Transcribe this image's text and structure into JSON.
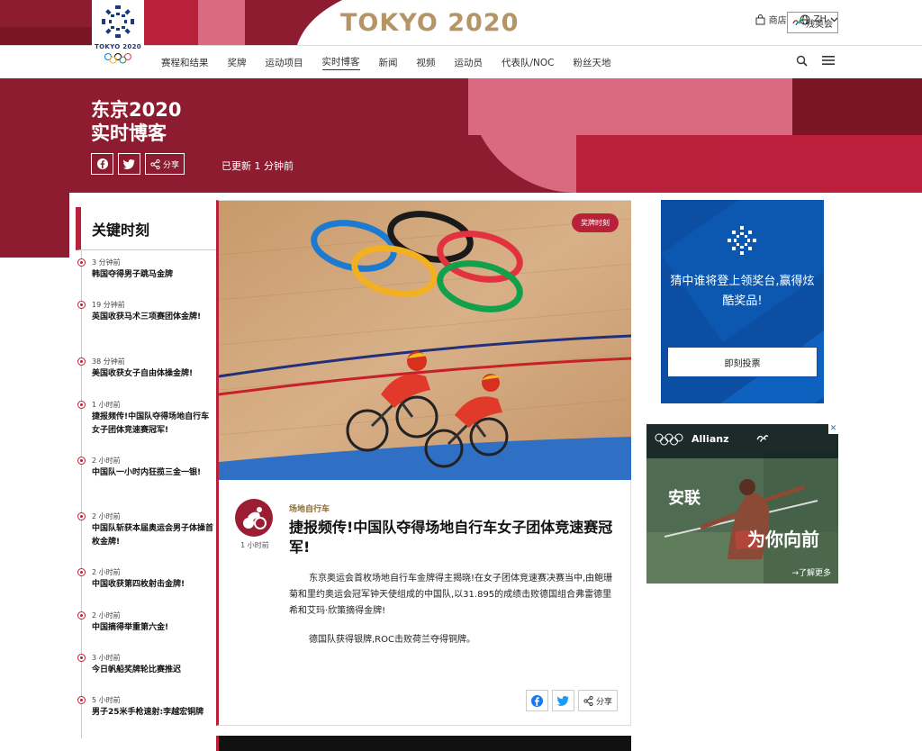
{
  "header": {
    "logo_text": "TOKYO 2020",
    "wordmark": "TOKYO 2020",
    "shop_label": "商店",
    "lang_label": "ZH",
    "paralympic_label": "残奥会"
  },
  "nav": {
    "items": [
      {
        "label": "赛程和结果",
        "active": false
      },
      {
        "label": "奖牌",
        "active": false
      },
      {
        "label": "运动项目",
        "active": false
      },
      {
        "label": "实时博客",
        "active": true
      },
      {
        "label": "新闻",
        "active": false
      },
      {
        "label": "视频",
        "active": false
      },
      {
        "label": "运动员",
        "active": false
      },
      {
        "label": "代表队/NOC",
        "active": false
      },
      {
        "label": "粉丝天地",
        "active": false
      }
    ]
  },
  "hero": {
    "title_line1": "东京2020",
    "title_line2": "实时博客",
    "share_label": "分享",
    "updated": "已更新 1 分钟前"
  },
  "moments": {
    "heading": "关键时刻",
    "items": [
      {
        "time": "3 分钟前",
        "headline": "韩国夺得男子跳马金牌"
      },
      {
        "time": "19 分钟前",
        "headline": "英国收获马术三项赛团体金牌!"
      },
      {
        "time": "38 分钟前",
        "headline": "美国收获女子自由体操金牌!"
      },
      {
        "time": "1 小时前",
        "headline": "捷报频传!中国队夺得场地自行车女子团体竞速赛冠军!"
      },
      {
        "time": "2 小时前",
        "headline": "中国队一小时内狂揽三金一银!"
      },
      {
        "time": "2 小时前",
        "headline": "中国队斩获本届奥运会男子体操首枚金牌!"
      },
      {
        "time": "2 小时前",
        "headline": "中国收获第四枚射击金牌!"
      },
      {
        "time": "2 小时前",
        "headline": "中国摘得举重第六金!"
      },
      {
        "time": "3 小时前",
        "headline": "今日帆船奖牌轮比赛推迟"
      },
      {
        "time": "5 小时前",
        "headline": "男子25米手枪速射:李越宏铜牌"
      }
    ]
  },
  "article": {
    "badge": "奖牌时刻",
    "ago": "1 小时前",
    "category": "场地自行车",
    "headline": "捷报频传!中国队夺得场地自行车女子团体竞速赛冠军!",
    "body1": "东京奥运会首枚场地自行车金牌得主揭晓!在女子团体竞速赛决赛当中,由鲍珊菊和里约奥运会冠军钟天使组成的中国队,以31.895的成绩击败德国组合弗雷德里希和艾玛·欣策摘得金牌!",
    "body2": "德国队获得银牌,ROC击败荷兰夺得铜牌。",
    "share_label": "分享"
  },
  "ads": {
    "vote_text": "猜中谁将登上领奖台,赢得炫酷奖品!",
    "vote_button": "即刻投票",
    "allianz_brand": "Allianz",
    "allianz_headline1": "安联",
    "allianz_headline2": "为你向前",
    "allianz_more": "→了解更多"
  },
  "colors": {
    "brand_red": "#b9213a",
    "dark_red": "#8d1c30",
    "pink": "#d96a80",
    "gold": "#b59566",
    "ad_blue": "#0b4ea2"
  }
}
